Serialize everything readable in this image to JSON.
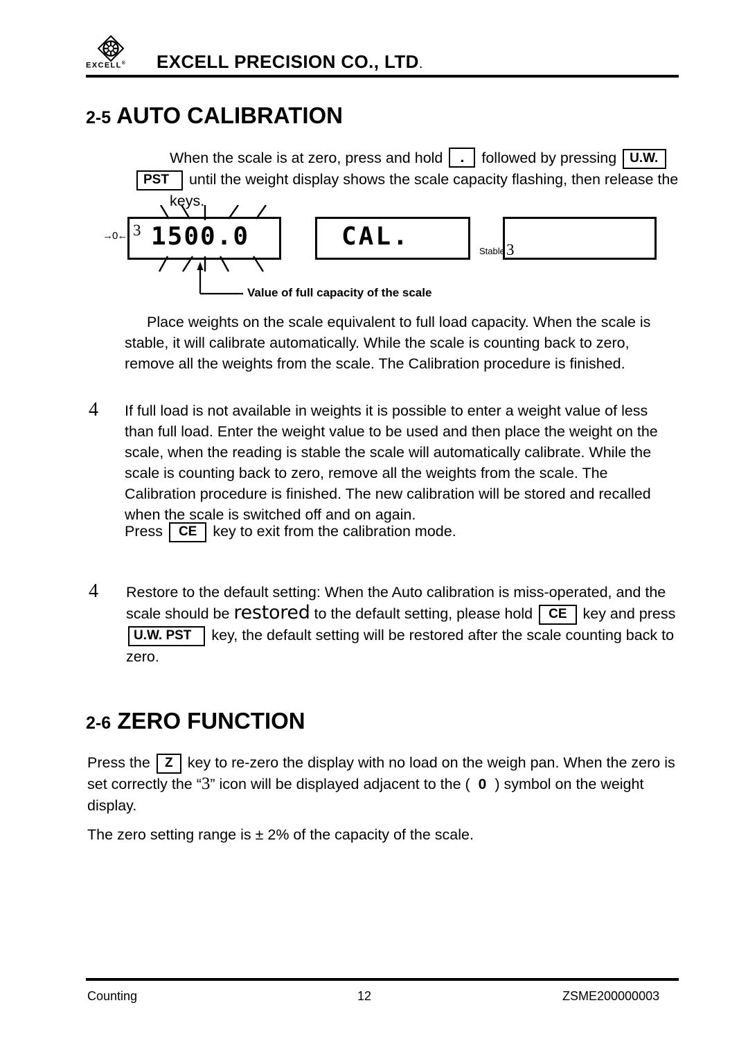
{
  "header": {
    "logo_word": "EXCELL",
    "logo_registered": "®",
    "company": "EXCELL PRECISION CO., LTD",
    "company_period": "."
  },
  "sections": {
    "auto_calibration": {
      "number": "2-5",
      "title": "AUTO CALIBRATION",
      "intro": {
        "t1": "When the scale is at zero, press and hold",
        "key1": ".",
        "t2": "followed by pressing",
        "key2": "U.W.",
        "key3": "PST",
        "t3": "until the weight display shows the scale capacity flashing, then release the keys."
      },
      "displays": {
        "lcd1_value": "1500.0",
        "lcd1_zero_indicator": "→0←",
        "lcd1_stable_marker": "3",
        "lcd2_value": "CAL.",
        "lcd3_value": "",
        "lcd3_stable_label": "Stable",
        "lcd3_stable_marker": "3",
        "caption": "Value of full capacity of the scale"
      },
      "para_place": "Place weights on the scale equivalent to full load capacity.    When the scale is stable, it will calibrate automatically.    While the scale is counting back to zero, remove all the weights from the scale.    The Calibration procedure is finished.",
      "bullet1": {
        "marker": "4",
        "text": "If full load is not available in weights it is possible to enter a weight value of less than full load.    Enter the weight value to be used and then place the weight on the scale, when the reading is stable the scale will automatically calibrate. While the scale is counting back to zero, remove all the weights from the scale. The Calibration procedure is finished.    The new calibration will be stored and recalled when the scale is switched off and on again."
      },
      "press_ce": {
        "t1": "Press",
        "key": "CE",
        "t2": "key to exit from the calibration mode."
      },
      "bullet2": {
        "marker": "4",
        "t1": "Restore to the default setting: When the Auto calibration is miss-operated, and the scale should be",
        "emph": "restored",
        "t2": "to the default setting, please hold",
        "key1": "CE",
        "t3": "key and press",
        "key2": "U.W. PST",
        "t4": "key, the default setting will be restored after the scale counting back to zero."
      }
    },
    "zero_function": {
      "number": "2-6",
      "title": "ZERO FUNCTION",
      "para1": {
        "t1": "Press the",
        "key": "Z",
        "t2": "key to re-zero the display with no load on the weigh pan. When the zero is set correctly the “",
        "glyph": "3",
        "t3": "” icon will be displayed adjacent to the (",
        "zero_symbol": "0",
        "t4": ") symbol on the weight display."
      },
      "para2": "The zero setting range is ± 2% of the capacity of the scale."
    }
  },
  "footer": {
    "left": "Counting",
    "page": "12",
    "right": "ZSME200000003"
  },
  "colors": {
    "ink": "#000000",
    "paper": "#ffffff"
  }
}
